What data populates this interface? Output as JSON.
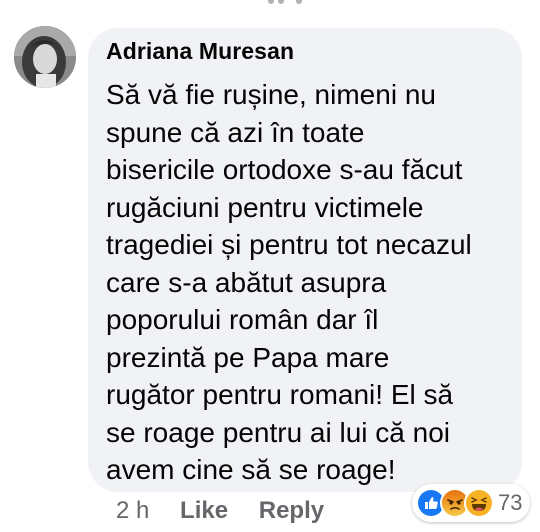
{
  "comment": {
    "author": "Adriana Muresan",
    "lines": [
      "Să vă fie rușine, nimeni nu",
      "spune că azi în toate",
      "bisericile ortodoxe s-au făcut",
      "rugăciuni pentru victimele",
      "tragediei și pentru tot necazul",
      "care s-a abătut asupra",
      "poporului român dar îl",
      "prezintă pe Papa mare",
      "rugător pentru romani! El să",
      "se roage pentru ai lui că noi",
      "avem cine să se roage!"
    ]
  },
  "footer": {
    "time": "2 h",
    "like_label": "Like",
    "reply_label": "Reply"
  },
  "reactions": {
    "icons": [
      "like-icon",
      "angry-icon",
      "haha-icon"
    ],
    "count": "73"
  },
  "colors": {
    "bubble": "#f0f2f5",
    "text": "#050505",
    "secondary": "#65676b",
    "like_blue": "#1877f2",
    "angry_orange": "#e9710f",
    "haha_yellow": "#f7b125"
  }
}
